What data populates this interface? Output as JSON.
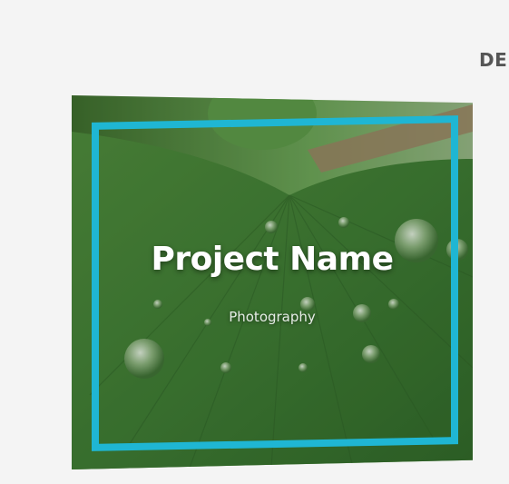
{
  "nav": {
    "partial_label": "DE"
  },
  "card": {
    "title": "Project Name",
    "subtitle": "Photography",
    "frame_color": "#1fb6d3"
  }
}
